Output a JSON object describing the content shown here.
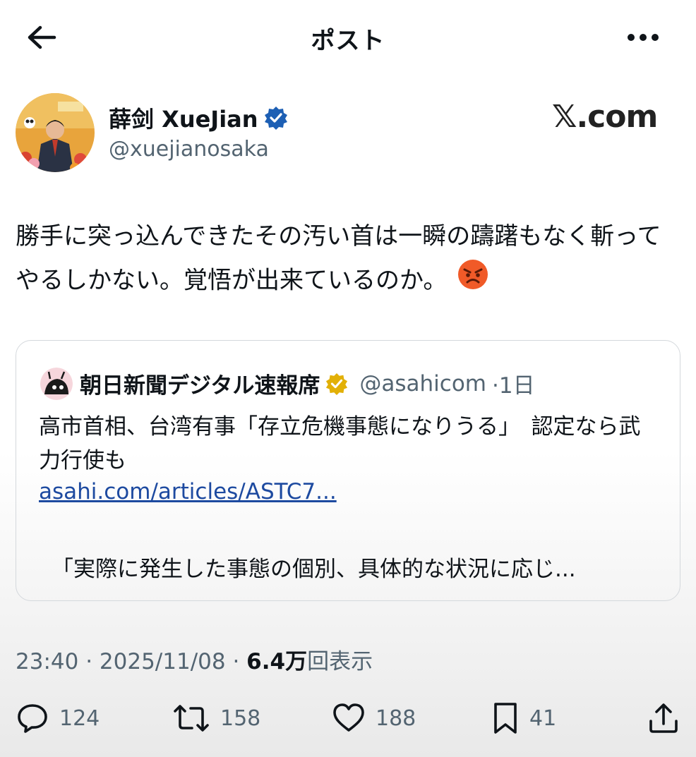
{
  "header": {
    "title": "ポスト",
    "back_icon": "arrow-left-icon",
    "more_icon": "more-horizontal-icon"
  },
  "author": {
    "name": "薛剑 XueJian",
    "handle": "@xuejianosaka",
    "verified": true
  },
  "watermark": {
    "x_glyph": "𝕏",
    "domain": ".com"
  },
  "tweet": {
    "text": "勝手に突っ込んできたその汚い首は一瞬の躊躇もなく斬ってやるしかない。覚悟が出来ているのか。",
    "emoji": "angry-face-icon"
  },
  "quote": {
    "name": "朝日新聞デジタル速報席",
    "handle": "@asahicom",
    "time": "·1日",
    "text": "高市首相、台湾有事「存立危機事態になりうる」　認定なら武力行使も",
    "link": "asahi.com/articles/ASTC7...",
    "excerpt": "「実際に発生した事態の個別、具体的な状況に応じ..."
  },
  "meta": {
    "time": "23:40",
    "sep1": " · ",
    "date": "2025/11/08",
    "sep2": " · ",
    "views": "6.4万",
    "views_label": "回表示"
  },
  "actions": {
    "reply_count": "124",
    "repost_count": "158",
    "like_count": "188",
    "bookmark_count": "41"
  },
  "colors": {
    "text": "#0f1419",
    "secondary": "#536471",
    "verified_blue": "#1d5fb4",
    "verified_gold": "#e2b007",
    "link": "#1d4aa0"
  }
}
